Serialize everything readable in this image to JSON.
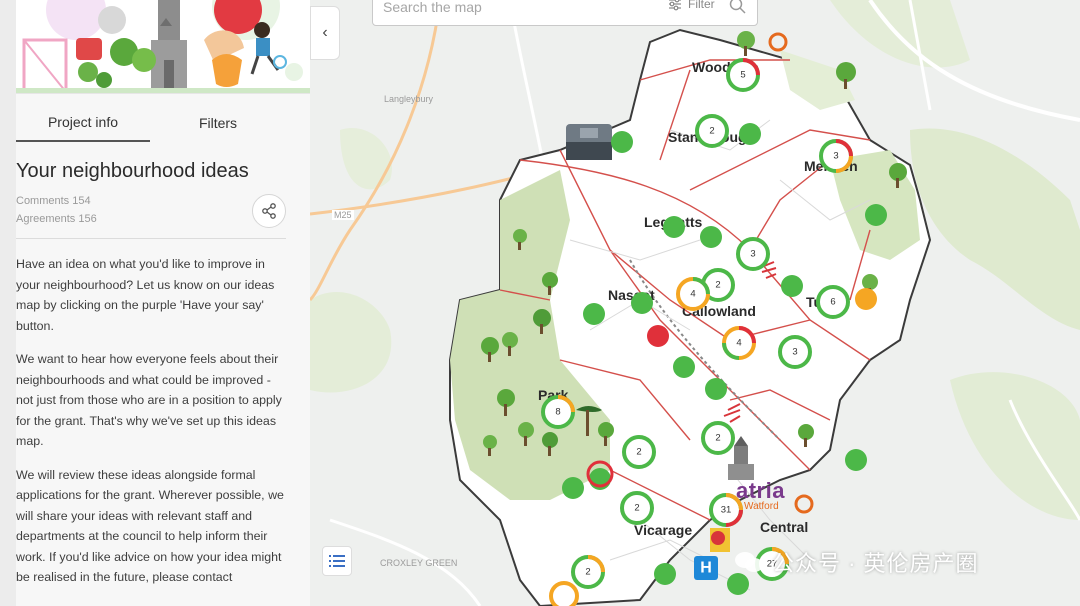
{
  "sidebar": {
    "tabs": [
      {
        "label": "Project info",
        "active": true
      },
      {
        "label": "Filters",
        "active": false
      }
    ],
    "title": "Your neighbourhood ideas",
    "comments": "Comments 154",
    "agreements": "Agreements 156",
    "paragraphs": [
      "Have an idea on what you'd like to improve in your neighbourhood? Let us know on our ideas map by clicking on the purple 'Have your say' button.",
      "We want to hear how everyone feels about their neighbourhoods and what could be improved - not just from those who are in a position to apply for the grant. That's why we've set up this ideas map.",
      "We will review these ideas alongside formal applications for the grant. Wherever possible, we will share your ideas with relevant staff and departments at the council to help inform their work. If you'd like advice on how your idea might be realised in the future, please contact"
    ]
  },
  "search": {
    "placeholder": "Search the map",
    "filter_label": "Filter"
  },
  "map": {
    "places": {
      "woodside": "Woodside",
      "stanborough": "Stanborough",
      "meriden": "Meriden",
      "leggatts": "Leggatts",
      "nascot": "Nascot",
      "callowland": "Callowland",
      "tudor": "Tudor",
      "park": "Park",
      "vicarage": "Vicarage",
      "central": "Central"
    },
    "faint_places": {
      "langleybury": "Langleybury",
      "croxley_green": "CROXLEY GREEN",
      "m25": "M25"
    },
    "landmark": {
      "name": "atria",
      "sub": "Watford"
    },
    "pin_counts": {
      "woodside": "5",
      "stanborough": "2",
      "meriden": "3",
      "leggatts_e": "3",
      "callowland_a": "2",
      "nascot": "4",
      "tudor": "6",
      "callowland_b": "4",
      "callowland_c": "3",
      "park": "8",
      "central_n": "2",
      "park_s": "2",
      "vicarage_n": "2",
      "central": "31",
      "south_w": "2",
      "south_e": "27"
    },
    "colors": {
      "green": "#4cb848",
      "red": "#e0303a",
      "orange": "#f5a623",
      "ward": "#d4504c",
      "parkland": "#cfe0b6"
    }
  },
  "watermark": "公众号 · 英伦房产圈"
}
